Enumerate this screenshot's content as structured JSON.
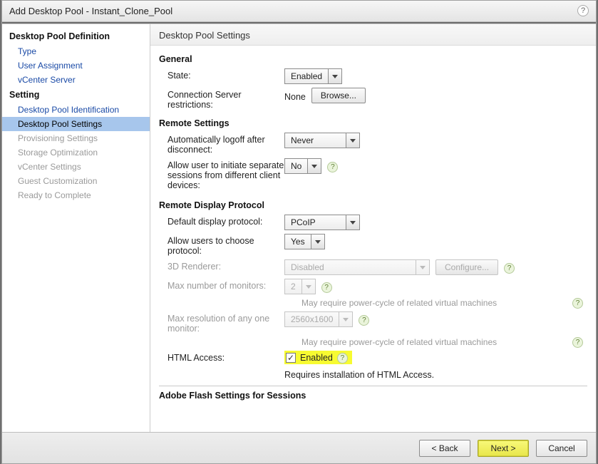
{
  "title": "Add Desktop Pool - Instant_Clone_Pool",
  "sidebar": {
    "heading1": "Desktop Pool Definition",
    "items1": [
      "Type",
      "User Assignment",
      "vCenter Server"
    ],
    "heading2": "Setting",
    "items2": [
      "Desktop Pool Identification",
      "Desktop Pool Settings",
      "Provisioning Settings",
      "Storage Optimization",
      "vCenter Settings",
      "Guest Customization",
      "Ready to Complete"
    ]
  },
  "content_title": "Desktop Pool Settings",
  "general": {
    "heading": "General",
    "state_label": "State:",
    "state_value": "Enabled",
    "csr_label": "Connection Server restrictions:",
    "csr_value": "None",
    "browse": "Browse..."
  },
  "remote": {
    "heading": "Remote Settings",
    "logoff_label": "Automatically logoff after disconnect:",
    "logoff_value": "Never",
    "sessions_label": "Allow user to initiate separate sessions from different client devices:",
    "sessions_value": "No"
  },
  "display": {
    "heading": "Remote Display Protocol",
    "proto_label": "Default display protocol:",
    "proto_value": "PCoIP",
    "choose_label": "Allow users to choose protocol:",
    "choose_value": "Yes",
    "render_label": "3D Renderer:",
    "render_value": "Disabled",
    "configure": "Configure...",
    "monitors_label": "Max number of monitors:",
    "monitors_value": "2",
    "hint1": "May require power-cycle of related virtual machines",
    "res_label": "Max resolution of any one monitor:",
    "res_value": "2560x1600",
    "hint2": "May require power-cycle of related virtual machines",
    "html_label": "HTML Access:",
    "html_check": "Enabled",
    "html_note": "Requires installation of HTML Access."
  },
  "flash_heading": "Adobe Flash Settings for Sessions",
  "footer": {
    "back": "< Back",
    "next": "Next >",
    "cancel": "Cancel"
  }
}
